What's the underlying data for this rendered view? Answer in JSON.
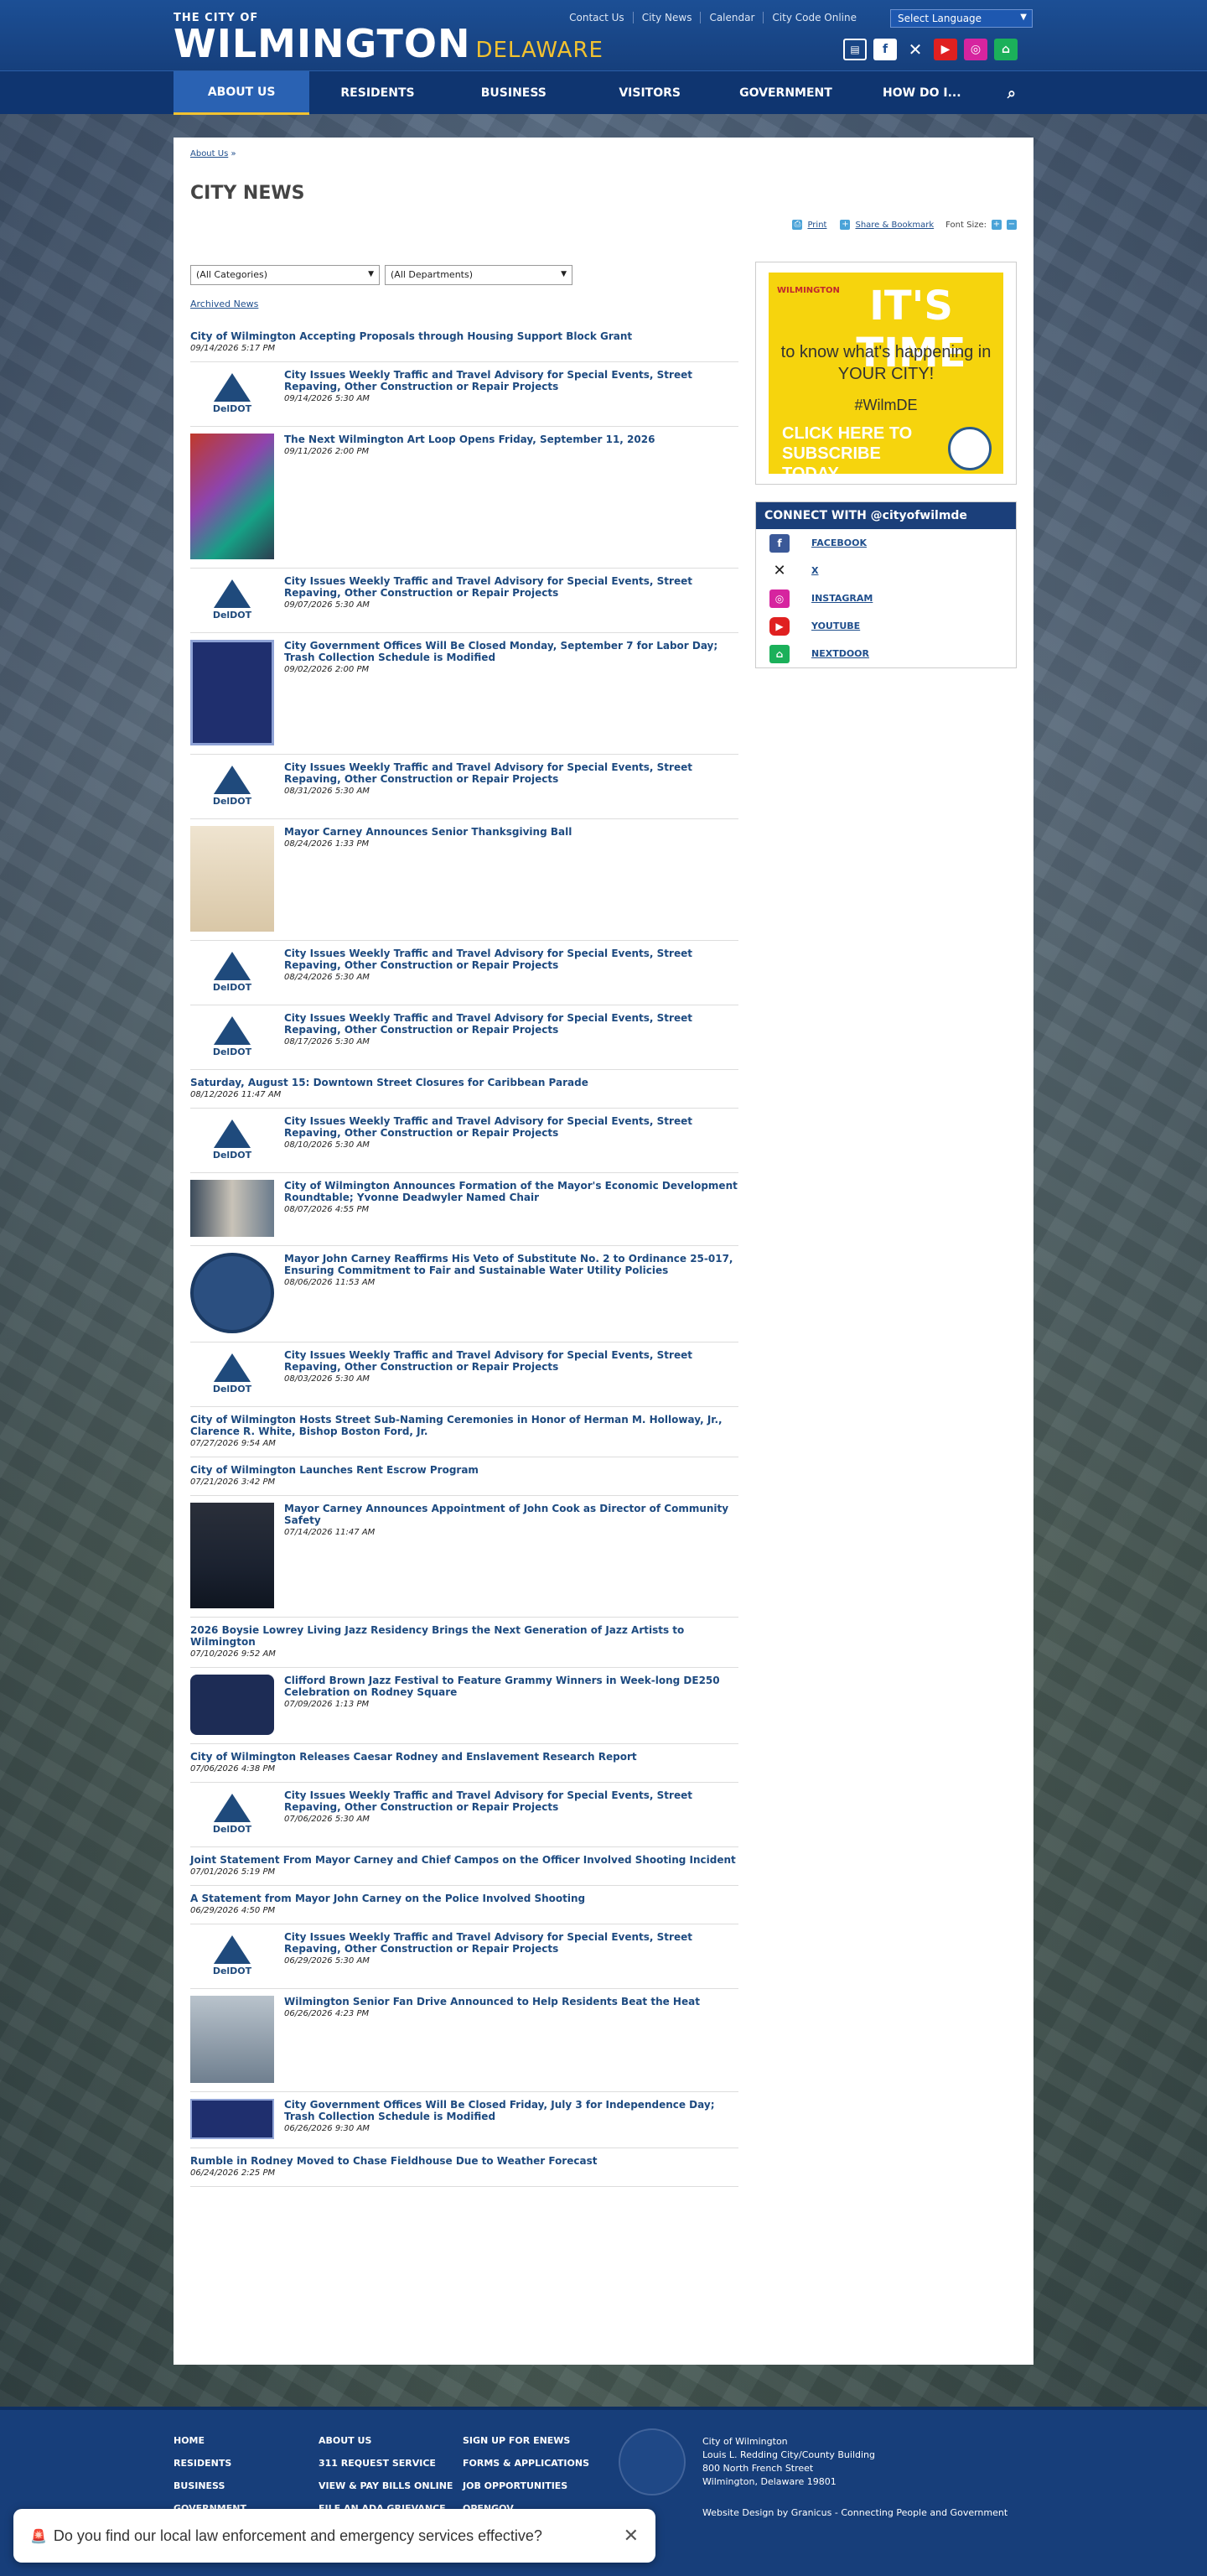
{
  "header": {
    "logo_small": "THE CITY OF",
    "logo_big": "WILMINGTON",
    "logo_state": "DELAWARE",
    "toplinks": [
      "Contact Us",
      "City News",
      "Calendar",
      "City Code Online"
    ],
    "language": "Select Language"
  },
  "nav": [
    "ABOUT US",
    "RESIDENTS",
    "BUSINESS",
    "VISITORS",
    "GOVERNMENT",
    "HOW DO I..."
  ],
  "breadcrumb": {
    "link": "About Us",
    "sep": "»"
  },
  "page_title": "CITY NEWS",
  "tools": {
    "print": "Print",
    "share": "Share & Bookmark",
    "font_size": "Font Size:"
  },
  "filters": {
    "categories": "(All Categories)",
    "departments": "(All Departments)"
  },
  "archived": "Archived News",
  "news": [
    {
      "title": "City of Wilmington Accepting Proposals through Housing Support Block Grant",
      "date": "09/14/2026 5:17 PM",
      "thumb": "none"
    },
    {
      "title": "City Issues Weekly Traffic and Travel Advisory for Special Events, Street Repaving, Other Construction or Repair Projects",
      "date": "09/14/2026 5:30 AM",
      "thumb": "deldot"
    },
    {
      "title": "The Next Wilmington Art Loop Opens Friday, September 11, 2026",
      "date": "09/11/2026 2:00 PM",
      "thumb": "art"
    },
    {
      "title": "City Issues Weekly Traffic and Travel Advisory for Special Events, Street Repaving, Other Construction or Repair Projects",
      "date": "09/07/2026 5:30 AM",
      "thumb": "deldot"
    },
    {
      "title": "City Government Offices Will Be Closed Monday, September 7 for Labor Day; Trash Collection Schedule is Modified",
      "date": "09/02/2026 2:00 PM",
      "thumb": "sched"
    },
    {
      "title": "City Issues Weekly Traffic and Travel Advisory for Special Events, Street Repaving, Other Construction or Repair Projects",
      "date": "08/31/2026 5:30 AM",
      "thumb": "deldot"
    },
    {
      "title": "Mayor Carney Announces Senior Thanksgiving Ball",
      "date": "08/24/2026 1:33 PM",
      "thumb": "invite"
    },
    {
      "title": "City Issues Weekly Traffic and Travel Advisory for Special Events, Street Repaving, Other Construction or Repair Projects",
      "date": "08/24/2026 5:30 AM",
      "thumb": "deldot"
    },
    {
      "title": "City Issues Weekly Traffic and Travel Advisory for Special Events, Street Repaving, Other Construction or Repair Projects",
      "date": "08/17/2026 5:30 AM",
      "thumb": "deldot"
    },
    {
      "title": "Saturday, August 15: Downtown Street Closures for Caribbean Parade",
      "date": "08/12/2026 11:47 AM",
      "thumb": "none"
    },
    {
      "title": "City Issues Weekly Traffic and Travel Advisory for Special Events, Street Repaving, Other Construction or Repair Projects",
      "date": "08/10/2026 5:30 AM",
      "thumb": "deldot"
    },
    {
      "title": "City of Wilmington Announces Formation of the Mayor's Economic Development Roundtable; Yvonne Deadwyler Named Chair",
      "date": "08/07/2026 4:55 PM",
      "thumb": "photo"
    },
    {
      "title": "Mayor John Carney Reaffirms His Veto of Substitute No. 2 to Ordinance 25-017, Ensuring Commitment to Fair and Sustainable Water Utility Policies",
      "date": "08/06/2026 11:53 AM",
      "thumb": "seal"
    },
    {
      "title": "City Issues Weekly Traffic and Travel Advisory for Special Events, Street Repaving, Other Construction or Repair Projects",
      "date": "08/03/2026 5:30 AM",
      "thumb": "deldot"
    },
    {
      "title": "City of Wilmington Hosts Street Sub-Naming Ceremonies in Honor of Herman M. Holloway, Jr., Clarence R. White, Bishop Boston Ford, Jr.",
      "date": "07/27/2026 9:54 AM",
      "thumb": "none"
    },
    {
      "title": "City of Wilmington Launches Rent Escrow Program",
      "date": "07/21/2026 3:42 PM",
      "thumb": "none"
    },
    {
      "title": "Mayor Carney Announces Appointment of John Cook as Director of Community Safety",
      "date": "07/14/2026 11:47 AM",
      "thumb": "portrait"
    },
    {
      "title": "2026 Boysie Lowrey Living Jazz Residency Brings the Next Generation of Jazz Artists to Wilmington",
      "date": "07/10/2026 9:52 AM",
      "thumb": "none"
    },
    {
      "title": "Clifford Brown Jazz Festival to Feature Grammy Winners in Week-long DE250 Celebration on Rodney Square",
      "date": "07/09/2026 1:13 PM",
      "thumb": "jazz"
    },
    {
      "title": "City of Wilmington Releases Caesar Rodney and Enslavement Research Report",
      "date": "07/06/2026 4:38 PM",
      "thumb": "none"
    },
    {
      "title": "City Issues Weekly Traffic and Travel Advisory for Special Events, Street Repaving, Other Construction or Repair Projects",
      "date": "07/06/2026 5:30 AM",
      "thumb": "deldot"
    },
    {
      "title": "Joint Statement From Mayor Carney and Chief Campos on the Officer Involved Shooting Incident",
      "date": "07/01/2026 5:19 PM",
      "thumb": "none"
    },
    {
      "title": "A Statement from Mayor John Carney on the Police Involved Shooting",
      "date": "06/29/2026 4:50 PM",
      "thumb": "none"
    },
    {
      "title": "City Issues Weekly Traffic and Travel Advisory for Special Events, Street Repaving, Other Construction or Repair Projects",
      "date": "06/29/2026 5:30 AM",
      "thumb": "deldot"
    },
    {
      "title": "Wilmington Senior Fan Drive Announced to Help Residents Beat the Heat",
      "date": "06/26/2026 4:23 PM",
      "thumb": "fans"
    },
    {
      "title": "City Government Offices Will Be Closed Friday, July 3 for Independence Day; Trash Collection Schedule is Modified",
      "date": "06/26/2026 9:30 AM",
      "thumb": "banner"
    },
    {
      "title": "Rumble in Rodney Moved to Chase Fieldhouse Due to Weather Forecast",
      "date": "06/24/2026 2:25 PM",
      "thumb": "none"
    }
  ],
  "deldot_label": "DelDOT",
  "promo": {
    "wilm": "WILMINGTON",
    "line1": "IT'S TIME",
    "line2": "to know what's happening in YOUR CITY!",
    "line3": "#WilmDE",
    "line4": "CLICK HERE TO SUBSCRIBE TODAY"
  },
  "connect": {
    "heading": "CONNECT WITH @cityofwilmde",
    "items": [
      "FACEBOOK",
      "X",
      "INSTAGRAM",
      "YOUTUBE",
      "NEXTDOOR"
    ]
  },
  "footer": {
    "col1": [
      "HOME",
      "RESIDENTS",
      "BUSINESS",
      "GOVERNMENT"
    ],
    "col2": [
      "ABOUT US",
      "311 REQUEST SERVICE",
      "VIEW & PAY BILLS ONLINE",
      "FILE AN ADA GRIEVANCE"
    ],
    "col3": [
      "SIGN UP FOR ENEWS",
      "FORMS & APPLICATIONS",
      "JOB OPPORTUNITIES",
      "OPENGOV"
    ],
    "address": [
      "City of Wilmington",
      "Louis L. Redding City/County Building",
      "800 North French Street",
      "Wilmington, Delaware 19801"
    ],
    "credit": "Website Design by Granicus - Connecting People and Government"
  },
  "survey": {
    "icon": "🚨",
    "question": "Do you find our local law enforcement and emergency services effective?",
    "close": "✕"
  },
  "colors": {
    "brand": "#1c4f95",
    "accent": "#f2c230",
    "link": "#1d4a80"
  }
}
